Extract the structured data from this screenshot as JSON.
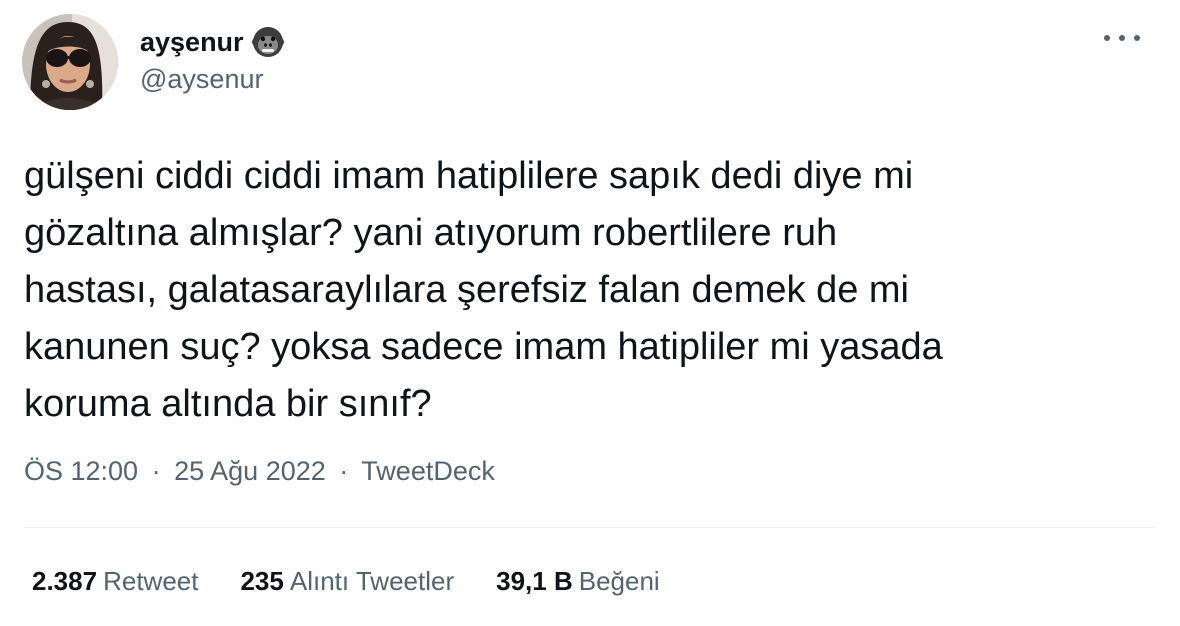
{
  "user": {
    "display_name": "ayşenur",
    "handle": "@aysenur",
    "name_emoji": "gorilla-emoji"
  },
  "tweet": {
    "lines": [
      "gülşeni ciddi ciddi imam hatiplilere sapık dedi diye mi",
      "gözaltına almışlar? yani atıyorum robertlilere ruh",
      "hastası, galatasaraylılara şerefsiz falan demek de mi",
      "kanunen suç? yoksa sadece imam hatipliler mi yasada",
      "koruma altında bir sınıf?"
    ]
  },
  "meta": {
    "time": "ÖS 12:00",
    "date": "25 Ağu 2022",
    "source": "TweetDeck",
    "separator": "·"
  },
  "stats": {
    "retweets": {
      "count": "2.387",
      "label": "Retweet"
    },
    "quotes": {
      "count": "235",
      "label": "Alıntı Tweetler"
    },
    "likes": {
      "count": "39,1 B",
      "label": "Beğeni"
    }
  },
  "colors": {
    "text_primary": "#0f1419",
    "text_secondary": "#536471",
    "divider": "#eff3f4"
  }
}
